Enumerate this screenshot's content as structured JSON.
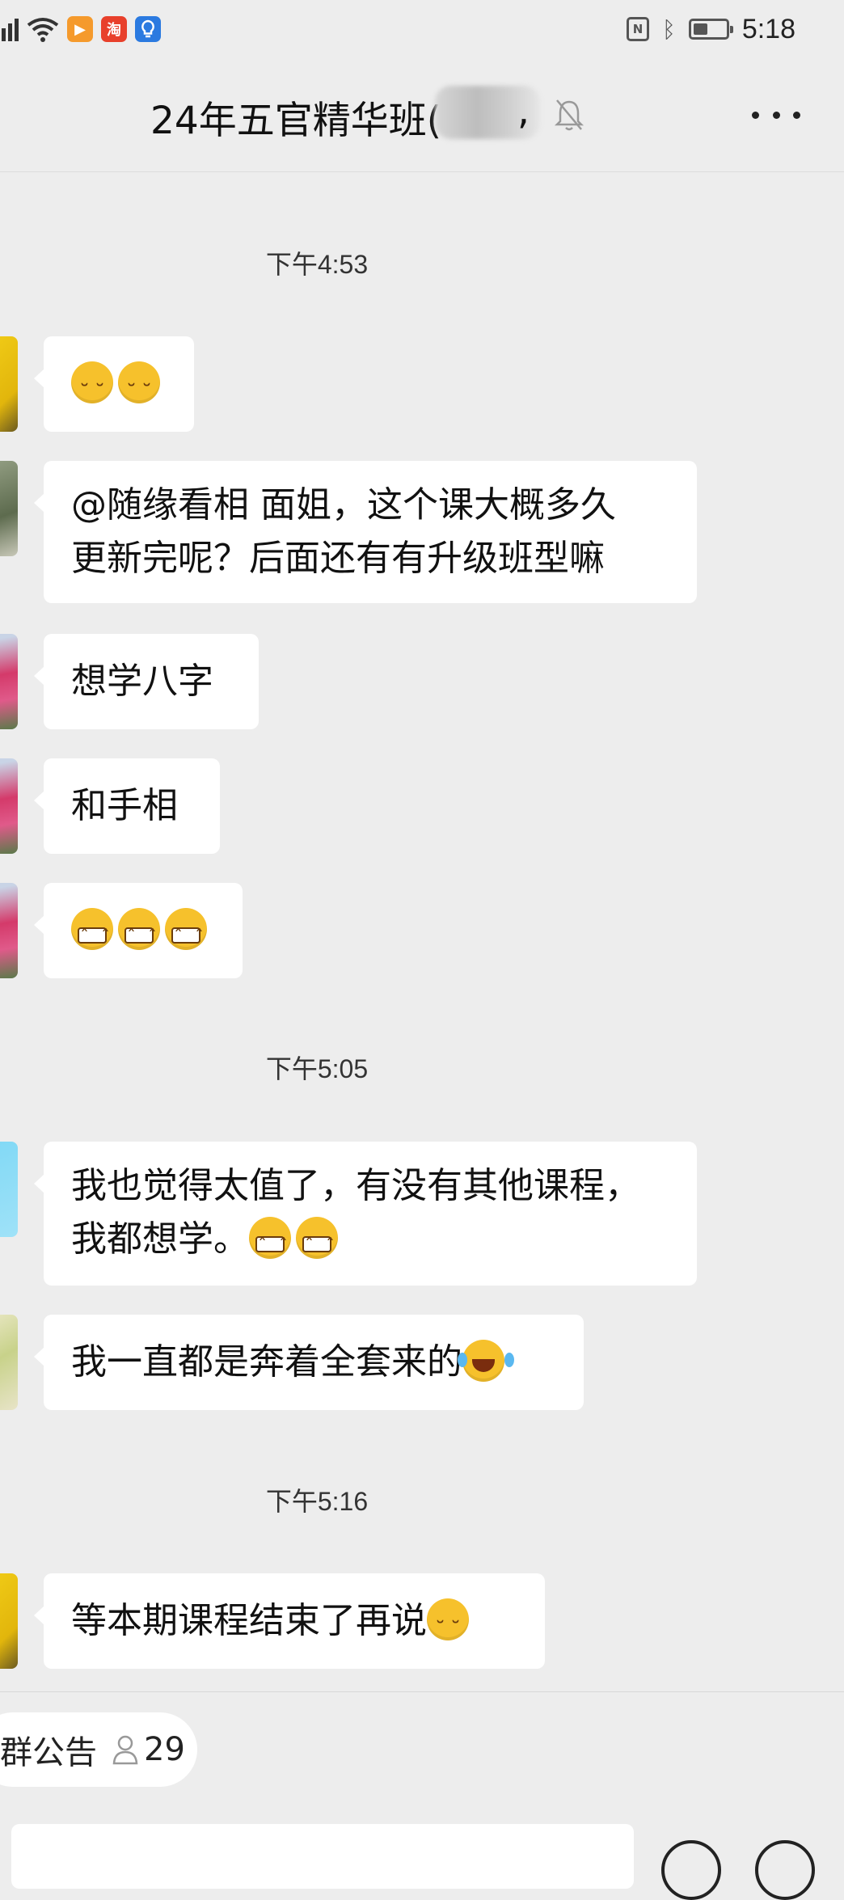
{
  "status_bar": {
    "time": "5:18",
    "battery_level": 0.45,
    "icons": [
      "signal-icon",
      "wifi-icon",
      "video-app-icon",
      "taobao-app-icon",
      "bulb-app-icon",
      "nfc-icon",
      "bluetooth-icon",
      "battery-icon"
    ],
    "taobao_label": "淘"
  },
  "header": {
    "title": "24年五官精华班(",
    "title_suffix": ",",
    "icons": [
      "mute-bell-icon",
      "more-icon"
    ]
  },
  "messages": [
    {
      "type": "time",
      "text": "下午4:53"
    },
    {
      "type": "msg",
      "text": "",
      "emoji": [
        "shy",
        "shy"
      ]
    },
    {
      "type": "msg",
      "lines": [
        "@随缘看相  面姐，这个课大概多久",
        "更新完呢？后面还有有升级班型嘛"
      ]
    },
    {
      "type": "msg",
      "text": "想学八字"
    },
    {
      "type": "msg",
      "text": "和手相"
    },
    {
      "type": "msg",
      "text": "",
      "emoji": [
        "grin",
        "grin",
        "grin"
      ]
    },
    {
      "type": "time",
      "text": "下午5:05"
    },
    {
      "type": "msg",
      "lines": [
        "我也觉得太值了，有没有其他课程，",
        "我都想学。"
      ],
      "emoji": [
        "grin",
        "grin"
      ]
    },
    {
      "type": "msg",
      "text": "我一直都是奔着全套来的",
      "emoji": [
        "laugh"
      ]
    },
    {
      "type": "time",
      "text": "下午5:16"
    },
    {
      "type": "msg",
      "text": "等本期课程结束了再说",
      "emoji": [
        "shy"
      ]
    }
  ],
  "notice": {
    "label": "群公告",
    "count": "29"
  },
  "colors": {
    "background": "#ededed",
    "bubble": "#ffffff",
    "accent_badge": "#f0a030"
  }
}
